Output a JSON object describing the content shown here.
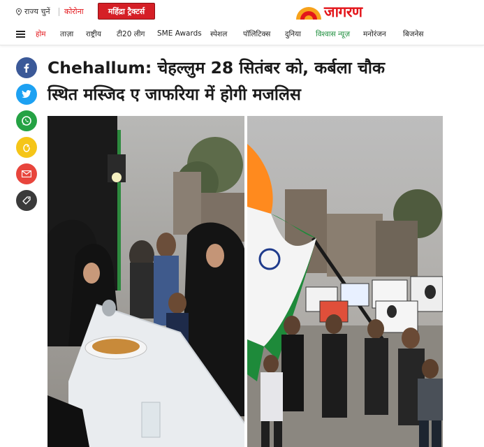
{
  "header": {
    "location_label": "राज्य चुनें",
    "corona_label": "कोरोना",
    "promo_label": "महिंद्रा ट्रैक्टर्स",
    "logo_text": "जागरण"
  },
  "nav": {
    "items": [
      {
        "label": "होम",
        "active": true
      },
      {
        "label": "ताज़ा",
        "active": false
      },
      {
        "label": "राष्ट्रीय",
        "active": false
      },
      {
        "label": "टी20 लीग",
        "active": false
      },
      {
        "label": "SME Awards",
        "active": false
      },
      {
        "label": "स्पेशल",
        "active": false
      },
      {
        "label": "पॉलिटिक्स",
        "active": false
      },
      {
        "label": "दुनिया",
        "active": false
      },
      {
        "label": "विश्वास न्यूज़",
        "active": false
      },
      {
        "label": "मनोरंजन",
        "active": false
      },
      {
        "label": "बिजनेस",
        "active": false
      }
    ]
  },
  "share": {
    "facebook_icon": "facebook-icon",
    "twitter_icon": "twitter-icon",
    "whatsapp_icon": "whatsapp-icon",
    "koo_icon": "koo-icon",
    "email_icon": "email-icon",
    "link_icon": "link-icon"
  },
  "article": {
    "headline_line1": "Chehallum: चेहल्लुम 28 सितंबर को, कर्बला चौक",
    "headline_line2": "स्थित मस्जिद ए जाफरिया में होगी मजलिस"
  },
  "colors": {
    "brand_red": "#e3161b",
    "facebook": "#3b5998",
    "twitter": "#1da1f2",
    "whatsapp": "#25a244",
    "koo": "#f5c518",
    "email": "#e8453c",
    "link": "#3a3a3a",
    "sponsored_green": "#1a8c3a"
  }
}
